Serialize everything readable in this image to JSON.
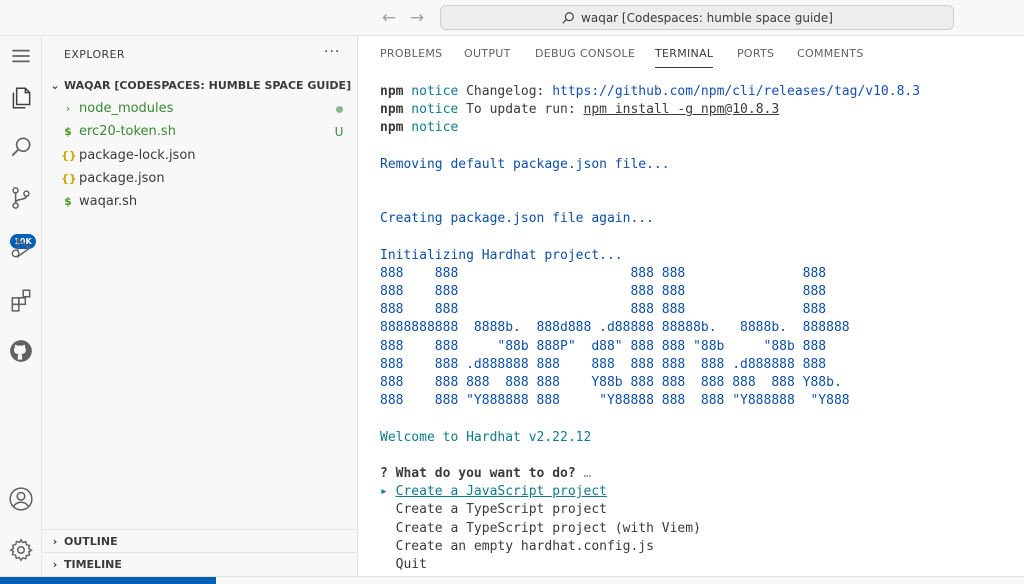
{
  "titlebar": {
    "back_icon": "arrow-left-icon",
    "forward_icon": "arrow-right-icon",
    "search_text": "waqar [Codespaces: humble space guide]"
  },
  "activity": {
    "source_control_badge": "10K",
    "icons": [
      "menu-icon",
      "files-icon",
      "search-icon",
      "source-control-icon",
      "run-debug-icon",
      "extensions-icon",
      "github-icon",
      "account-icon",
      "gear-icon"
    ]
  },
  "sidebar": {
    "title": "EXPLORER",
    "more": "···",
    "workspace": "WAQAR [CODESPACES: HUMBLE SPACE GUIDE]",
    "items": [
      {
        "icon": "›",
        "label": "node_modules",
        "deco": ""
      },
      {
        "icon": "$",
        "label": "erc20-token.sh",
        "deco": "U"
      },
      {
        "icon": "{}",
        "label": "package-lock.json",
        "deco": ""
      },
      {
        "icon": "{}",
        "label": "package.json",
        "deco": ""
      },
      {
        "icon": "$",
        "label": "waqar.sh",
        "deco": ""
      }
    ],
    "outline": "OUTLINE",
    "timeline": "TIMELINE"
  },
  "panel": {
    "tabs": [
      "PROBLEMS",
      "OUTPUT",
      "DEBUG CONSOLE",
      "TERMINAL",
      "PORTS",
      "COMMENTS"
    ],
    "active_tab": "TERMINAL"
  },
  "terminal": {
    "l1_npm": "npm",
    "l1_notice": " notice",
    "l1_text": " Changelog: ",
    "l1_link": "https://github.com/npm/cli/releases/tag/v10.8.3",
    "l2_npm": "npm",
    "l2_notice": " notice",
    "l2_text": " To update run: ",
    "l2_cmd": "npm install -g npm@10.8.3",
    "l3_npm": "npm",
    "l3_notice": " notice",
    "removing": "Removing default package.json file...",
    "creating": "Creating package.json file again...",
    "initializing": "Initializing Hardhat project...",
    "ascii": [
      "888    888                      888 888               888",
      "888    888                      888 888               888",
      "888    888                      888 888               888",
      "8888888888  8888b.  888d888 .d88888 88888b.   8888b.  888888",
      "888    888     \"88b 888P\"  d88\" 888 888 \"88b     \"88b 888",
      "888    888 .d888888 888    888  888 888  888 .d888888 888",
      "888    888 888  888 888    Y88b 888 888  888 888  888 Y88b.",
      "888    888 \"Y888888 888     \"Y88888 888  888 \"Y888888  \"Y888"
    ],
    "welcome": "Welcome to Hardhat v2.22.12",
    "question_mark": "?",
    "question": " What do you want to do?",
    "ellipsis": " …",
    "pointer": "▸",
    "options": [
      "Create a JavaScript project",
      "Create a TypeScript project",
      "Create a TypeScript project (with Viem)",
      "Create an empty hardhat.config.js",
      "Quit"
    ]
  }
}
